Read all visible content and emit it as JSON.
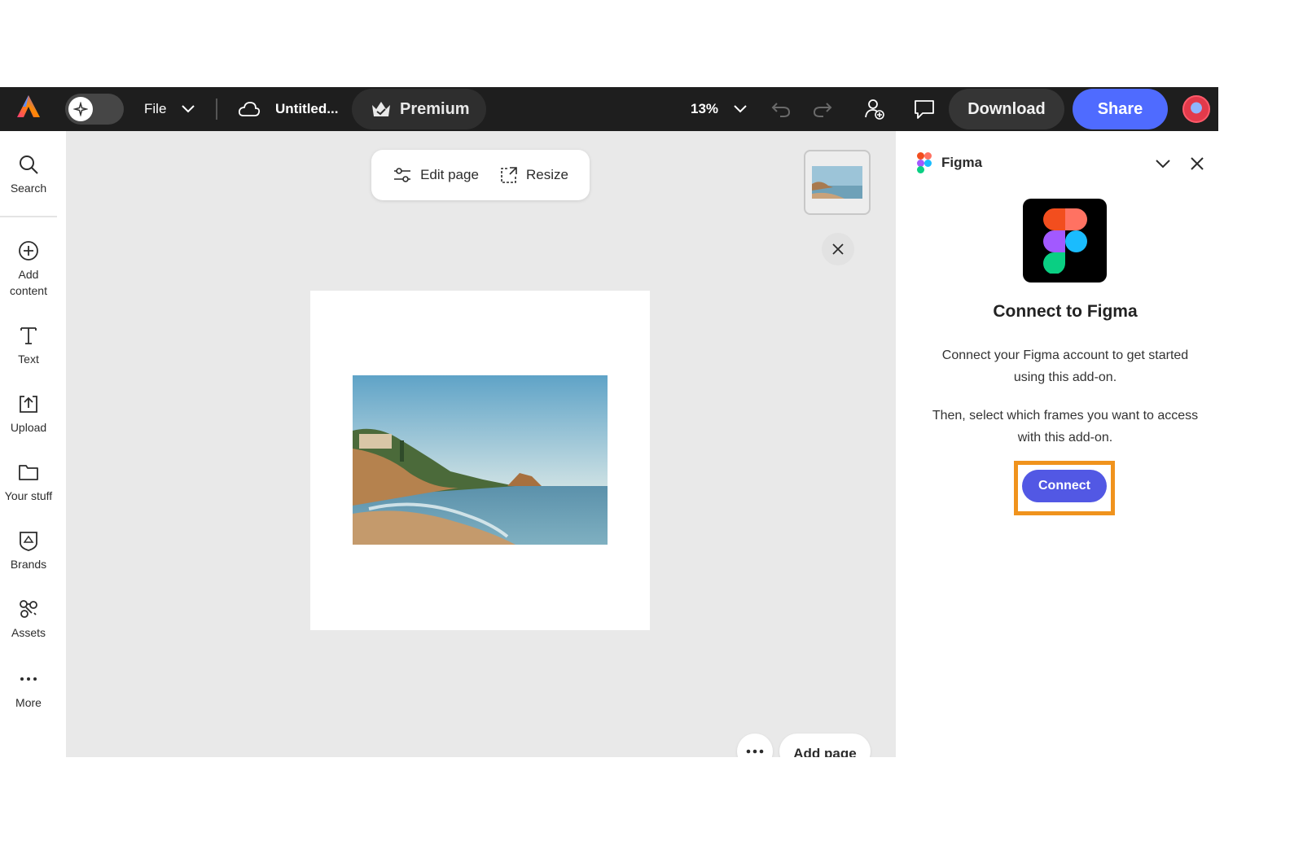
{
  "topbar": {
    "file_label": "File",
    "doc_title": "Untitled...",
    "premium_label": "Premium",
    "zoom_level": "13%",
    "download_label": "Download",
    "share_label": "Share"
  },
  "left_rail": {
    "items": [
      {
        "label": "Search",
        "icon": "search-icon"
      },
      {
        "label": "Add content",
        "icon": "plus-circle-icon"
      },
      {
        "label": "Text",
        "icon": "text-icon"
      },
      {
        "label": "Upload",
        "icon": "upload-icon"
      },
      {
        "label": "Your stuff",
        "icon": "folder-icon"
      },
      {
        "label": "Brands",
        "icon": "brands-icon"
      },
      {
        "label": "Assets",
        "icon": "assets-icon"
      },
      {
        "label": "More",
        "icon": "ellipsis-icon"
      }
    ]
  },
  "canvas": {
    "edit_page_label": "Edit page",
    "resize_label": "Resize",
    "add_page_label": "Add page"
  },
  "panel": {
    "addon_name": "Figma",
    "title": "Connect to Figma",
    "paragraph1": "Connect your Figma account to get started using this add-on.",
    "paragraph2": "Then, select which frames you want to access with this add-on.",
    "connect_label": "Connect"
  },
  "colors": {
    "topbar_bg": "#1e1e1e",
    "share_blue": "#4f6bff",
    "connect_purple": "#5258e4",
    "highlight_orange": "#f0931d",
    "canvas_bg": "#e9e9e9"
  }
}
